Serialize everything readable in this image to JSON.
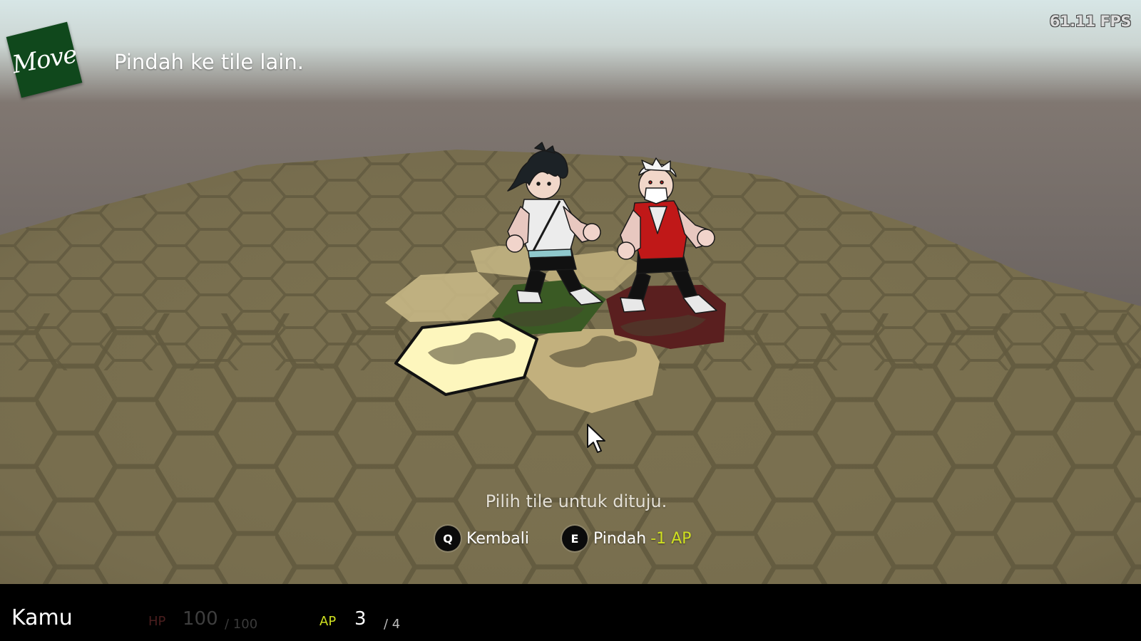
{
  "fps": "61.11 FPS",
  "action": {
    "badge_label": "Move",
    "description": "Pindah ke tile lain.",
    "badge_color": "#10481c"
  },
  "hint": "Pilih tile untuk dituju.",
  "controls": [
    {
      "key": "Q",
      "label": "Kembali"
    },
    {
      "key": "E",
      "label": "Pindah",
      "cost": "-1 AP"
    }
  ],
  "status": {
    "unit_name": "Kamu",
    "hp_label": "HP",
    "hp": "100",
    "hp_max": "/ 100",
    "ap_label": "AP",
    "ap": "3",
    "ap_max": "/ 4"
  },
  "scene": {
    "board_color": "#7b7150",
    "highlight_tile_color": "#c7b785",
    "selected_tile_color": "#fdf6bd",
    "player_tile_color": "#3a5a24",
    "enemy_tile_color": "#5a1f1f",
    "characters": [
      {
        "name": "player-character",
        "icon": "dark-haired-fighter",
        "shirt_color": "#e8e8e8"
      },
      {
        "name": "enemy-character",
        "icon": "white-haired-masked-fighter",
        "shirt_color": "#c01818"
      }
    ]
  }
}
